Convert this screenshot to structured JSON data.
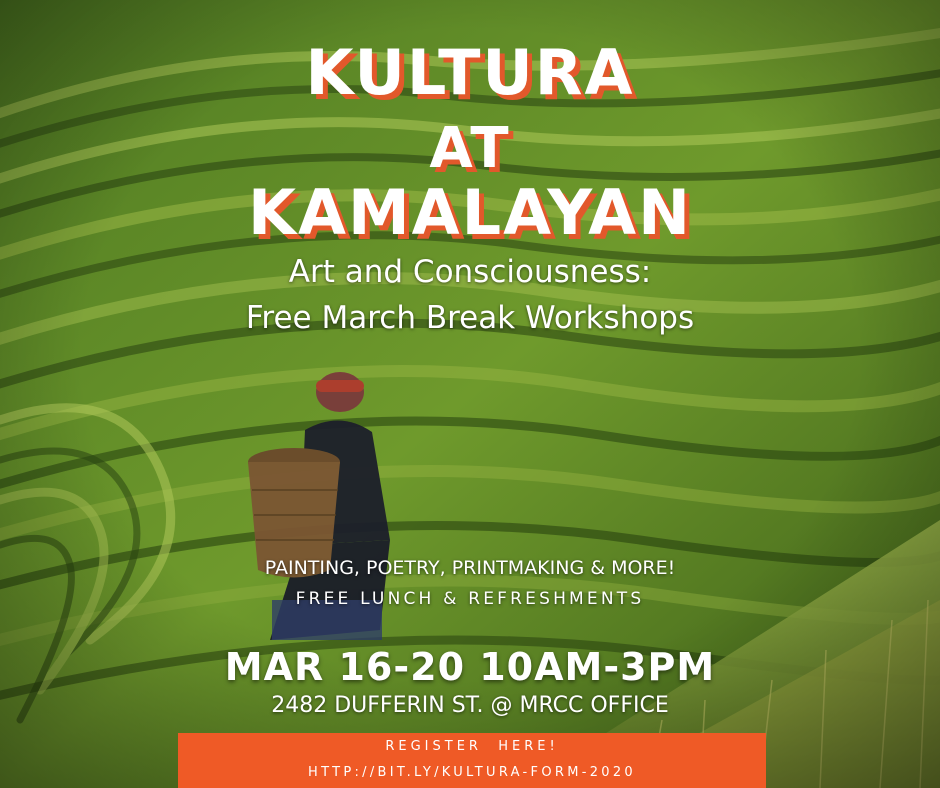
{
  "poster": {
    "title_line1": "KULTURA",
    "title_line2": "AT",
    "title_line3": "KAMALAYAN",
    "subtitle_line1": "Art and Consciousness:",
    "subtitle_line2": "Free March Break Workshops",
    "activities": "PAINTING, POETRY, PRINTMAKING & MORE!",
    "perks": "FREE LUNCH & REFRESHMENTS",
    "dates": "MAR 16-20 10AM-3PM",
    "address": "2482 DUFFERIN ST. @ MRCC OFFICE",
    "register_label": "REGISTER  HERE!",
    "register_url": "HTTP://BIT.LY/KULTURA-FORM-2020"
  },
  "colors": {
    "title_shadow": "#e2582b",
    "register_bg": "#ef5a26",
    "terrace_dark": "#2d4a15",
    "terrace_light": "#8fb23a"
  }
}
